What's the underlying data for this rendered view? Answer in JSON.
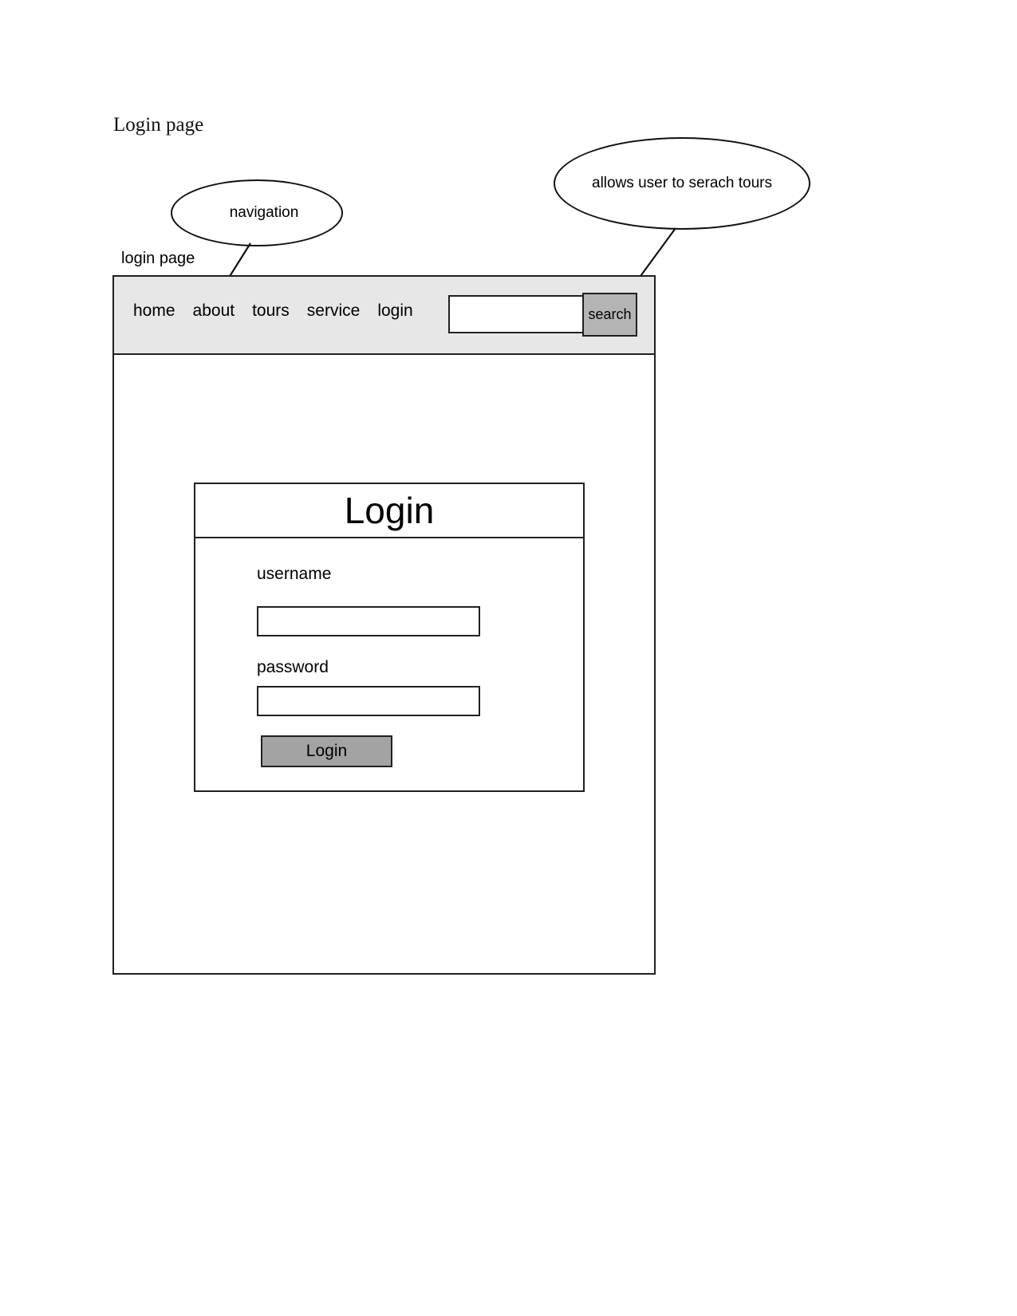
{
  "document": {
    "title": "Login page"
  },
  "annotations": [
    {
      "id": "navigation",
      "text": "navigation"
    },
    {
      "id": "search",
      "text": "allows user to serach tours"
    }
  ],
  "wireframe": {
    "label": "login page",
    "nav": {
      "links": [
        {
          "label": "home"
        },
        {
          "label": "about"
        },
        {
          "label": "tours"
        },
        {
          "label": "service"
        },
        {
          "label": "login"
        }
      ],
      "search": {
        "value": "",
        "placeholder": "",
        "button_label": "search"
      }
    },
    "login_card": {
      "title": "Login",
      "username": {
        "label": "username",
        "value": "",
        "placeholder": ""
      },
      "password": {
        "label": "password",
        "value": "",
        "placeholder": ""
      },
      "submit_label": "Login"
    }
  },
  "colors": {
    "nav_band": "#e7e7e7",
    "search_button": "#b4b4b4",
    "login_button": "#a3a3a3",
    "outline": "#231f20"
  }
}
